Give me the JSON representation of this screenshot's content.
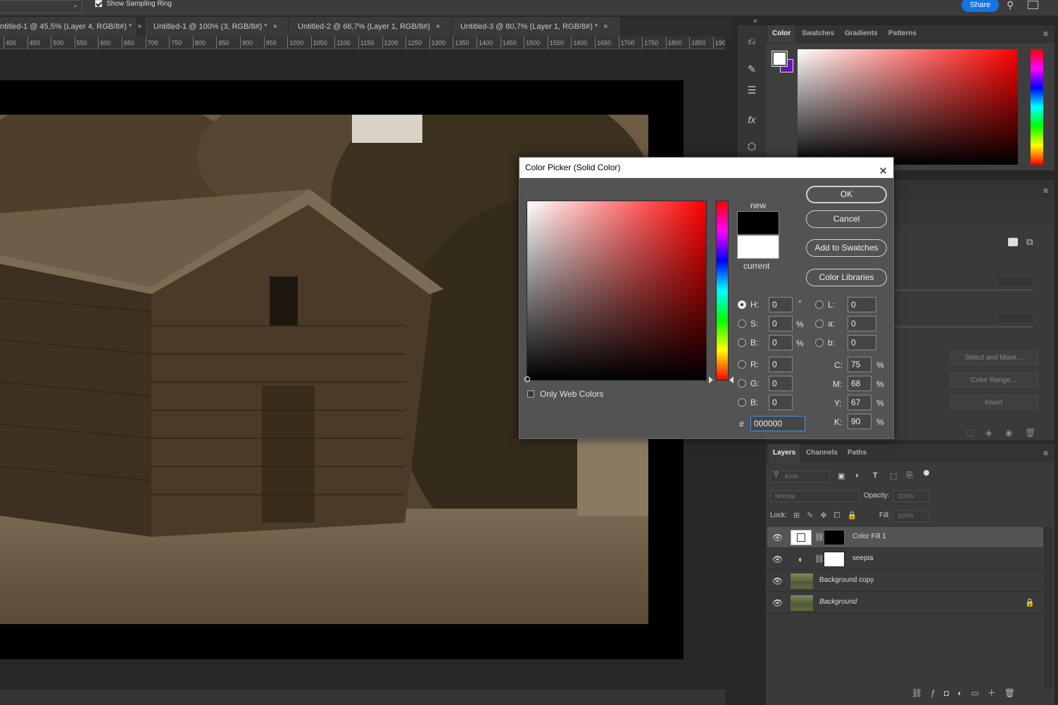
{
  "optionbar": {
    "sampling_ring_label": "Show Sampling Ring",
    "share_label": "Share"
  },
  "tabs": [
    {
      "label": "ntitled-1 @ 45,5% (Layer 4, RGB/8#) *"
    },
    {
      "label": "Untitled-1 @ 100% (3, RGB/8#) *"
    },
    {
      "label": "Untitled-2 @ 66,7% (Layer 1, RGB/8#)"
    },
    {
      "label": "Untitled-3 @ 80,7% (Layer 1, RGB/8#) *"
    }
  ],
  "ruler": [
    "400",
    "450",
    "500",
    "550",
    "600",
    "650",
    "700",
    "750",
    "800",
    "850",
    "900",
    "950",
    "1000",
    "1050",
    "1100",
    "1150",
    "1200",
    "1250",
    "1300",
    "1350",
    "1400",
    "1450",
    "1500",
    "1550",
    "1600",
    "1650",
    "1700",
    "1750",
    "1800",
    "1850",
    "1900"
  ],
  "color_panel": {
    "tabs": [
      "Color",
      "Swatches",
      "Gradients",
      "Patterns"
    ]
  },
  "mid_panel": {
    "tab_fragment": "es",
    "select_mask": "Select and Mask...",
    "color_range": "Color Range...",
    "invert": "Invert"
  },
  "layers_panel": {
    "tabs": [
      "Layers",
      "Channels",
      "Paths"
    ],
    "kind_placeholder": "Kind",
    "blend_mode": "Normal",
    "opacity_label": "Opacity:",
    "opacity_value": "100%",
    "lock_label": "Lock:",
    "fill_label": "Fill:",
    "fill_value": "100%",
    "layers": [
      {
        "name": "Color Fill 1"
      },
      {
        "name": "seepia"
      },
      {
        "name": "Background copy"
      },
      {
        "name": "Background"
      }
    ]
  },
  "dialog": {
    "title": "Color Picker (Solid Color)",
    "ok": "OK",
    "cancel": "Cancel",
    "add_swatches": "Add to Swatches",
    "color_libraries": "Color Libraries",
    "new_label": "new",
    "current_label": "current",
    "only_web": "Only Web Colors",
    "hsb": {
      "h": "0",
      "s": "0",
      "b": "0"
    },
    "rgb": {
      "r": "0",
      "g": "0",
      "b": "0"
    },
    "lab": {
      "l": "0",
      "a": "0",
      "b": "0"
    },
    "cmyk": {
      "c": "75",
      "m": "68",
      "y": "67",
      "k": "90"
    },
    "hex": "000000",
    "labels": {
      "h": "H:",
      "s": "S:",
      "b": "B:",
      "r": "R:",
      "g": "G:",
      "bb": "B:",
      "l": "L:",
      "a": "a:",
      "lb": "b:",
      "c": "C:",
      "m": "M:",
      "y": "Y:",
      "k": "K:",
      "hash": "#",
      "deg": "°",
      "pct": "%"
    }
  },
  "colors": {
    "accent": "#1473e6",
    "new_color": "#000000",
    "current_color": "#ffffff"
  }
}
